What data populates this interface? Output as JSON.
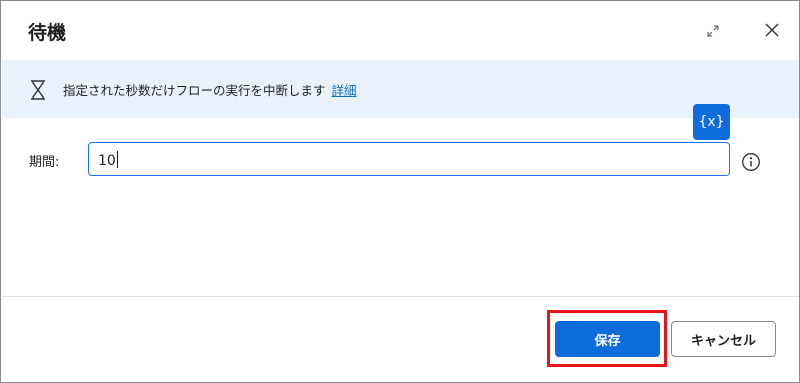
{
  "dialog": {
    "title": "待機",
    "expand_icon": "expand-icon",
    "close_icon": "close-icon"
  },
  "info_bar": {
    "icon": "hourglass-icon",
    "text": "指定された秒数だけフローの実行を中断します",
    "link_label": "詳細"
  },
  "variable_button": {
    "label": "{x}"
  },
  "duration_field": {
    "label": "期間:",
    "value": "10",
    "info_icon": "info-icon"
  },
  "footer": {
    "save_label": "保存",
    "cancel_label": "キャンセル",
    "highlight_color": "#e8141a"
  },
  "colors": {
    "accent": "#0f6cdc",
    "info_bar_bg": "#e9f1fb",
    "link": "#0f6cbd"
  }
}
